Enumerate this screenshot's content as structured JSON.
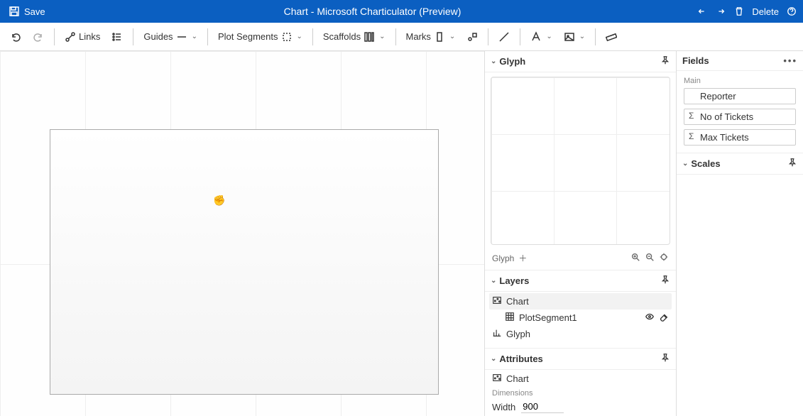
{
  "titlebar": {
    "save": "Save",
    "title": "Chart - Microsoft Charticulator (Preview)",
    "delete": "Delete"
  },
  "toolbar": {
    "links": "Links",
    "guides": "Guides",
    "plot_segments": "Plot Segments",
    "scaffolds": "Scaffolds",
    "marks": "Marks"
  },
  "glyph": {
    "title": "Glyph",
    "footer_label": "Glyph"
  },
  "layers": {
    "title": "Layers",
    "chart": "Chart",
    "plotsegment": "PlotSegment1",
    "glyph": "Glyph"
  },
  "attributes": {
    "title": "Attributes",
    "chart": "Chart",
    "dimensions": "Dimensions",
    "width_label": "Width",
    "width_value": "900"
  },
  "fields": {
    "title": "Fields",
    "main": "Main",
    "reporter": "Reporter",
    "tickets": "No of Tickets",
    "max": "Max Tickets"
  },
  "scales": {
    "title": "Scales"
  }
}
